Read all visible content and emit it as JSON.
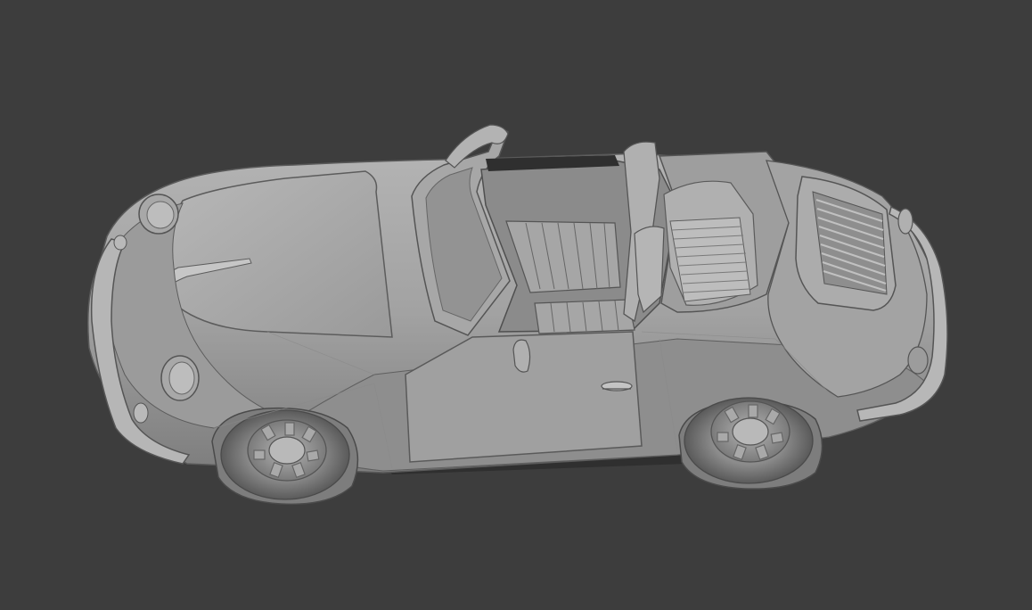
{
  "viewport": {
    "background_color": "#3d3d3d",
    "shading": "solid",
    "object": "car-3d-model"
  },
  "model": {
    "body_color": "#a4a4a4",
    "shadow_color": "#6e6e6e",
    "dark_color": "#2f2f2f",
    "highlight_color": "#c2c2c2",
    "outline_color": "#505050"
  }
}
